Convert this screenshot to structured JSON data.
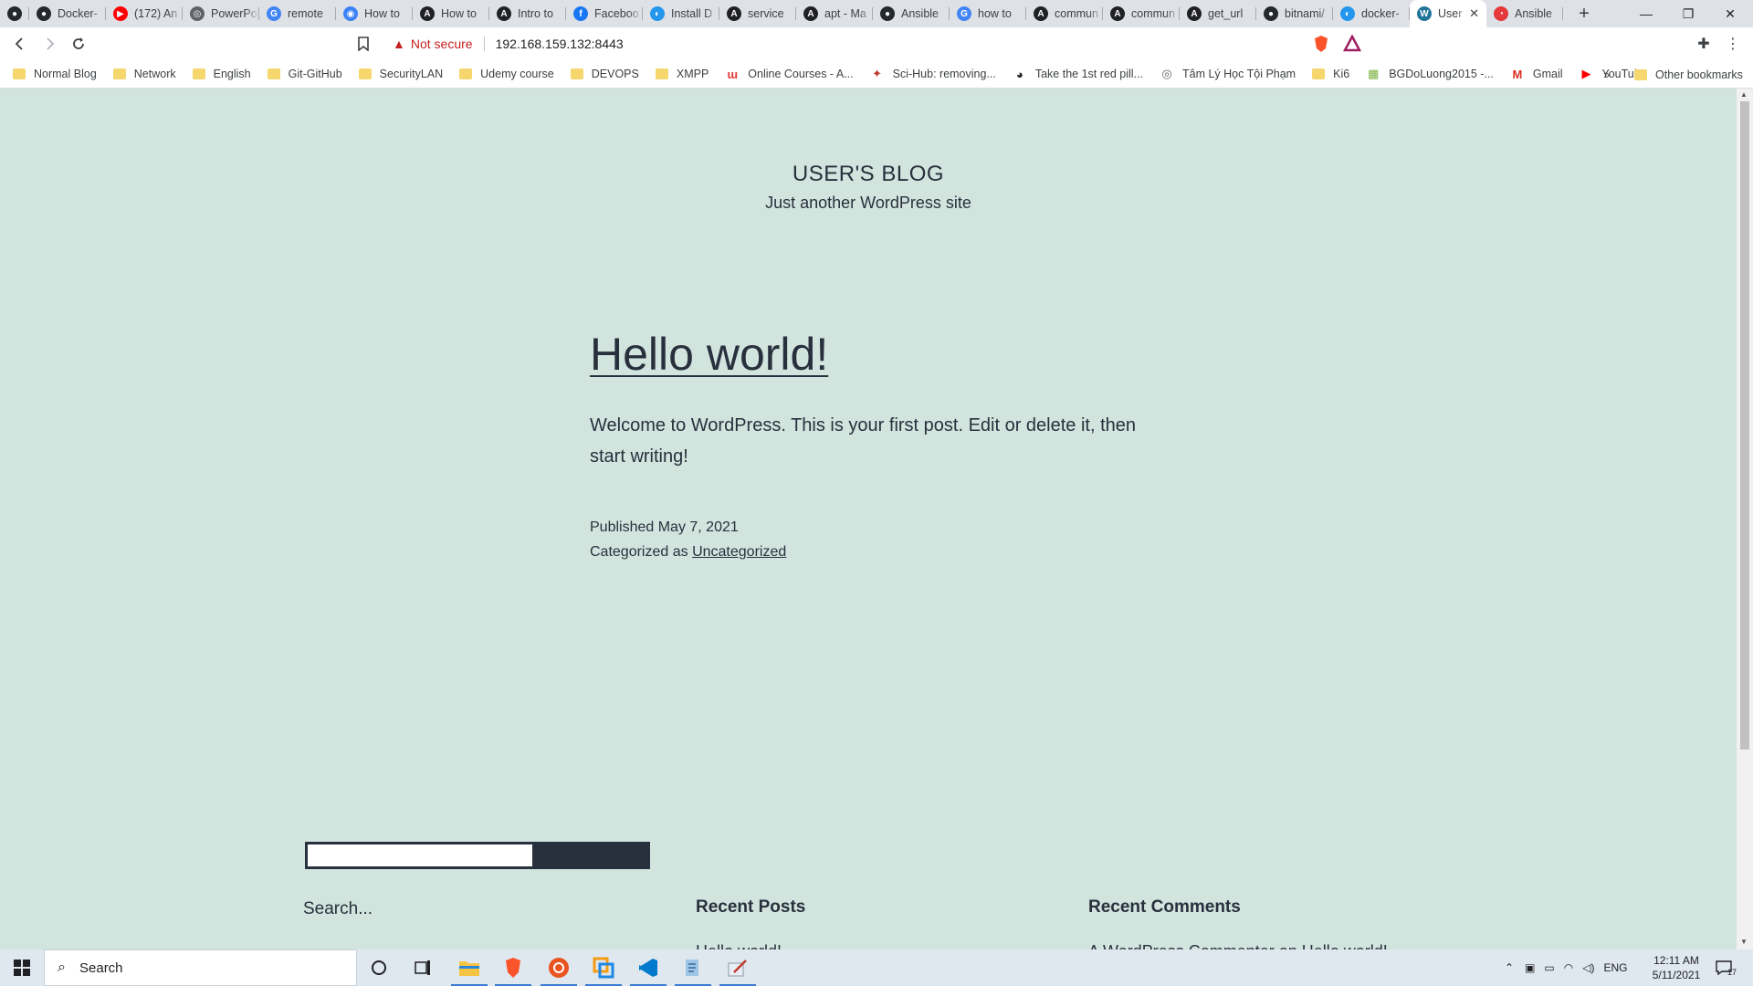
{
  "browser": {
    "tabs": [
      {
        "label": "",
        "icon": "github-icon",
        "color": "#24292e",
        "glyph": "●"
      },
      {
        "label": "Docker-",
        "icon": "github-icon",
        "color": "#24292e",
        "glyph": "●"
      },
      {
        "label": "(172) An",
        "icon": "youtube-icon",
        "color": "#ff0000",
        "glyph": "▶"
      },
      {
        "label": "PowerPo",
        "icon": "globe-icon",
        "color": "#5f6368",
        "glyph": "◎"
      },
      {
        "label": "remote",
        "icon": "google-icon",
        "color": "#4285f4",
        "glyph": "G"
      },
      {
        "label": "How to",
        "icon": "chat-icon",
        "color": "#3b82f6",
        "glyph": "◉"
      },
      {
        "label": "How to",
        "icon": "a-site-icon",
        "color": "#202124",
        "glyph": "A"
      },
      {
        "label": "Intro to",
        "icon": "a-site-icon",
        "color": "#202124",
        "glyph": "A"
      },
      {
        "label": "Faceboo",
        "icon": "facebook-icon",
        "color": "#1877f2",
        "glyph": "f"
      },
      {
        "label": "Install D",
        "icon": "docker-icon",
        "color": "#2496ed",
        "glyph": "◐"
      },
      {
        "label": "service",
        "icon": "a-site-icon",
        "color": "#202124",
        "glyph": "A"
      },
      {
        "label": "apt - Ma",
        "icon": "a-site-icon",
        "color": "#202124",
        "glyph": "A"
      },
      {
        "label": "Ansible",
        "icon": "github-icon",
        "color": "#24292e",
        "glyph": "●"
      },
      {
        "label": "how to",
        "icon": "google-icon",
        "color": "#4285f4",
        "glyph": "G"
      },
      {
        "label": "commun",
        "icon": "a-site-icon",
        "color": "#202124",
        "glyph": "A"
      },
      {
        "label": "commun",
        "icon": "a-site-icon",
        "color": "#202124",
        "glyph": "A"
      },
      {
        "label": "get_url",
        "icon": "a-site-icon",
        "color": "#202124",
        "glyph": "A"
      },
      {
        "label": "bitnami/",
        "icon": "github-icon",
        "color": "#24292e",
        "glyph": "●"
      },
      {
        "label": "docker-",
        "icon": "docker-icon",
        "color": "#2496ed",
        "glyph": "◐"
      },
      {
        "label": "User",
        "icon": "wordpress-icon",
        "color": "#21759b",
        "glyph": "W",
        "active": true
      },
      {
        "label": "Ansible",
        "icon": "ansible-icon",
        "color": "#e5383b",
        "glyph": "◔"
      }
    ],
    "address": {
      "security_label": "Not secure",
      "url": "192.168.159.132:8443"
    },
    "bookmarks": [
      {
        "label": "Normal Blog",
        "type": "folder"
      },
      {
        "label": "Network",
        "type": "folder"
      },
      {
        "label": "English",
        "type": "folder"
      },
      {
        "label": "Git-GitHub",
        "type": "folder"
      },
      {
        "label": "SecurityLAN",
        "type": "folder"
      },
      {
        "label": "Udemy course",
        "type": "folder"
      },
      {
        "label": "DEVOPS",
        "type": "folder"
      },
      {
        "label": "XMPP",
        "type": "folder"
      },
      {
        "label": "Online Courses - A...",
        "type": "site",
        "color": "#e53935",
        "glyph": "ɯ"
      },
      {
        "label": "Sci-Hub: removing...",
        "type": "site",
        "color": "#c0392b",
        "glyph": "✦"
      },
      {
        "label": "Take the 1st red pill...",
        "type": "site",
        "color": "#202124",
        "glyph": "◕"
      },
      {
        "label": "Tâm Lý Học Tội Phạm",
        "type": "site",
        "color": "#5f6368",
        "glyph": "◎"
      },
      {
        "label": "Ki6",
        "type": "folder"
      },
      {
        "label": "BGDoLuong2015 -...",
        "type": "site",
        "color": "#7cb342",
        "glyph": "▦"
      },
      {
        "label": "Gmail",
        "type": "site",
        "color": "#d93025",
        "glyph": "M"
      },
      {
        "label": "YouTube",
        "type": "site",
        "color": "#ff0000",
        "glyph": "▶"
      }
    ],
    "other_bookmarks": "Other bookmarks"
  },
  "site": {
    "title": "USER'S BLOG",
    "description": "Just another WordPress site"
  },
  "post": {
    "title": "Hello world!",
    "body": "Welcome to WordPress. This is your first post. Edit or delete it, then start writing!",
    "published": "Published May 7, 2021",
    "categorized_prefix": "Categorized as",
    "category": "Uncategorized"
  },
  "widgets": {
    "search_title": "Search...",
    "recent_posts_title": "Recent Posts",
    "recent_posts_first": "Hello world!",
    "recent_comments_title": "Recent Comments",
    "recent_comments_first": "A WordPress Commenter on Hello world!"
  },
  "taskbar": {
    "search_placeholder": "Search",
    "language": "ENG",
    "time": "12:11 AM",
    "date": "5/11/2021",
    "notifications": "17"
  },
  "colors": {
    "page_bg": "#d1e4dd",
    "text": "#28303d",
    "tabstrip": "#dee1e6"
  }
}
